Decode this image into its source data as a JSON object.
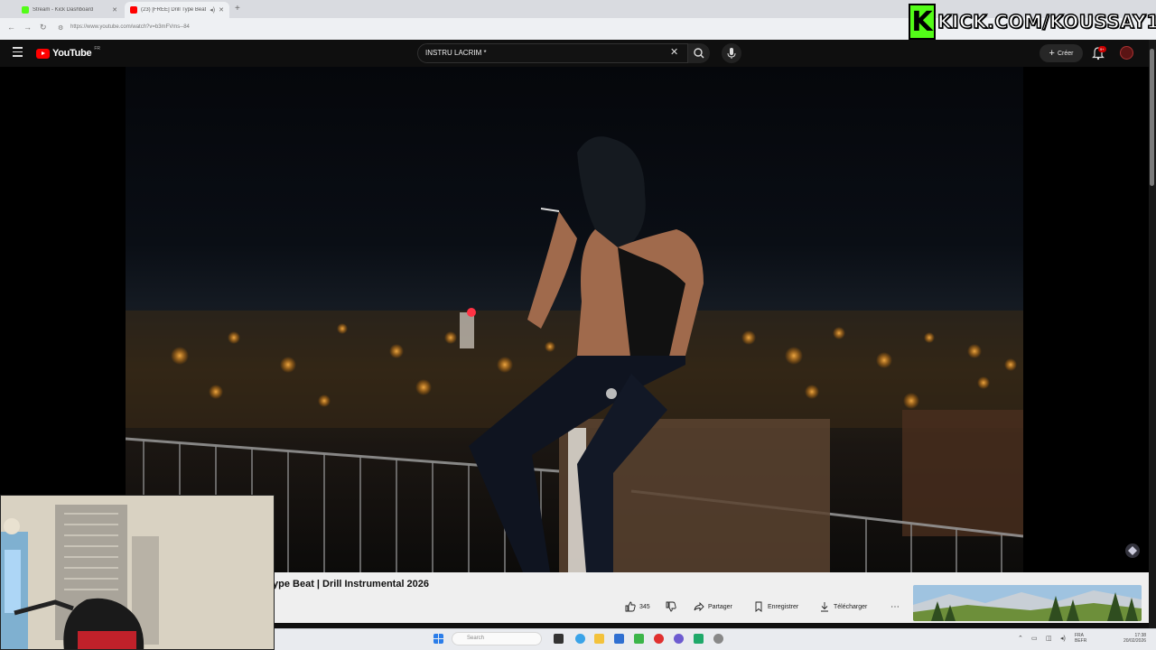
{
  "browser": {
    "tabs": [
      {
        "title": "Stream - Kick Dashboard",
        "favicon_color": "#53fc18",
        "active": false
      },
      {
        "title": "(23) [FREE] Drill Type Beat",
        "favicon_color": "#ff0000",
        "active": true
      }
    ],
    "url": "https://www.youtube.com/watch?v=b3mFVms--84"
  },
  "overlay": {
    "kick_logo": "K",
    "kick_text": "KICK.COM/KOUSSAY113"
  },
  "youtube": {
    "logo_text": "YouTube",
    "country_code": "FR",
    "search_value": "INSTRU LACRIM *",
    "create_label": "Créer",
    "notifications_count": "9+",
    "video_title": "ype Beat | Drill Instrumental 2026",
    "actions": {
      "likes": "345",
      "share": "Partager",
      "save": "Enregistrer",
      "download": "Télécharger"
    }
  },
  "taskbar": {
    "search_placeholder": "Search",
    "lang": "FRA",
    "lang2": "BEFR",
    "time": "17:38",
    "date": "20/02/2026"
  },
  "colors": {
    "accent": "#ff0000",
    "kick_green": "#53fc18",
    "bg": "#0f0f0f"
  }
}
